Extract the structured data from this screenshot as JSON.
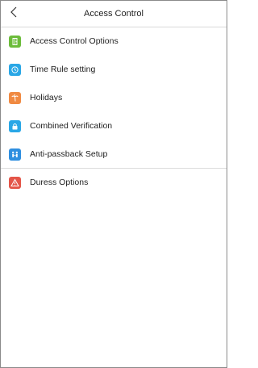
{
  "header": {
    "title": "Access Control",
    "back_icon": "chevron-left-icon"
  },
  "menu": {
    "items": [
      {
        "label": "Access Control Options",
        "icon": "door-icon",
        "color": "#6cbc3b"
      },
      {
        "label": "Time Rule setting",
        "icon": "clock-icon",
        "color": "#2aa7e6"
      },
      {
        "label": "Holidays",
        "icon": "palm-tree-icon",
        "color": "#f08a42"
      },
      {
        "label": "Combined Verification",
        "icon": "lock-icon",
        "color": "#2aa7e6"
      },
      {
        "label": "Anti-passback Setup",
        "icon": "people-arrows-icon",
        "color": "#2f8fe0"
      },
      {
        "label": "Duress Options",
        "icon": "warning-icon",
        "color": "#e45548"
      }
    ]
  }
}
